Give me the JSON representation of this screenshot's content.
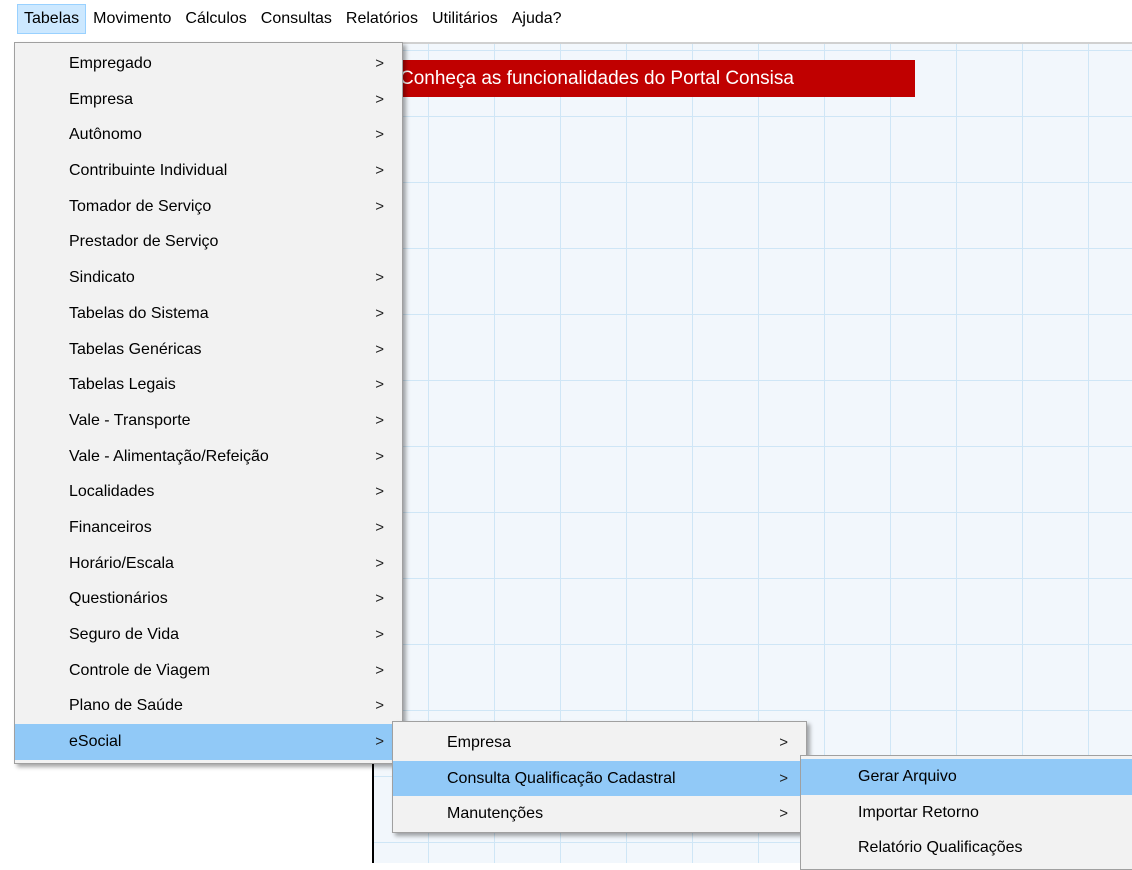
{
  "menubar": {
    "items": [
      "Tabelas",
      "Movimento",
      "Cálculos",
      "Consultas",
      "Relatórios",
      "Utilitários",
      "Ajuda?"
    ]
  },
  "banner": {
    "text": "Conheça as funcionalidades do Portal Consisa"
  },
  "menu_tabelas": {
    "items": [
      {
        "label": "Empregado",
        "submenu": true
      },
      {
        "label": "Empresa",
        "submenu": true
      },
      {
        "label": "Autônomo",
        "submenu": true
      },
      {
        "label": "Contribuinte Individual",
        "submenu": true
      },
      {
        "label": "Tomador de Serviço",
        "submenu": true
      },
      {
        "label": "Prestador de Serviço",
        "submenu": false
      },
      {
        "label": "Sindicato",
        "submenu": true
      },
      {
        "label": "Tabelas do Sistema",
        "submenu": true
      },
      {
        "label": "Tabelas Genéricas",
        "submenu": true
      },
      {
        "label": "Tabelas Legais",
        "submenu": true
      },
      {
        "label": "Vale - Transporte",
        "submenu": true
      },
      {
        "label": "Vale - Alimentação/Refeição",
        "submenu": true
      },
      {
        "label": "Localidades",
        "submenu": true
      },
      {
        "label": "Financeiros",
        "submenu": true
      },
      {
        "label": "Horário/Escala",
        "submenu": true
      },
      {
        "label": "Questionários",
        "submenu": true
      },
      {
        "label": "Seguro de Vida",
        "submenu": true
      },
      {
        "label": "Controle de Viagem",
        "submenu": true
      },
      {
        "label": "Plano de Saúde",
        "submenu": true
      },
      {
        "label": "eSocial",
        "submenu": true,
        "highlighted": true
      }
    ]
  },
  "menu_esocial": {
    "items": [
      {
        "label": "Empresa",
        "submenu": true
      },
      {
        "label": "Consulta Qualificação Cadastral",
        "submenu": true,
        "highlighted": true
      },
      {
        "label": "Manutenções",
        "submenu": true
      }
    ]
  },
  "menu_cqc": {
    "items": [
      {
        "label": "Gerar Arquivo",
        "highlighted": true
      },
      {
        "label": "Importar Retorno"
      },
      {
        "label": "Relatório Qualificações"
      }
    ]
  },
  "icons": {
    "submenu_arrow": "chevron-right-icon",
    "arrow_glyph": ">"
  },
  "colors": {
    "highlight": "#91c9f7",
    "banner": "#c00000",
    "menu_bg": "#f2f2f2",
    "menubar_active": "#cce8ff"
  }
}
